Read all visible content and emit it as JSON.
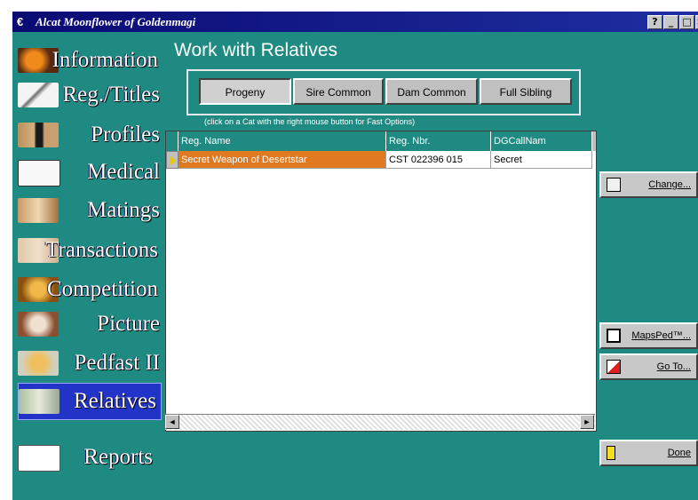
{
  "window": {
    "title": "Alcat Moonflower of Goldenmagi",
    "buttons": [
      "?",
      "_",
      "□",
      "×"
    ]
  },
  "nav": {
    "items": [
      {
        "label": "Information",
        "icon": "pumpkin-icon"
      },
      {
        "label": "Reg./Titles",
        "icon": "pen-icon"
      },
      {
        "label": "Profiles",
        "icon": "black-cat-icon"
      },
      {
        "label": "Medical",
        "icon": "caduceus-icon"
      },
      {
        "label": "Matings",
        "icon": "cats-icon"
      },
      {
        "label": "Transactions",
        "icon": "handshake-icon"
      },
      {
        "label": "Competition",
        "icon": "trophy-icon"
      },
      {
        "label": "Picture",
        "icon": "cat-face-icon"
      },
      {
        "label": "Pedfast II",
        "icon": "pedestal-icon"
      },
      {
        "label": "Relatives",
        "icon": "family-icon",
        "active": true
      },
      {
        "label": "Reports",
        "icon": "report-icon"
      }
    ]
  },
  "main": {
    "title": "Work with Relatives",
    "tabs": [
      {
        "label": "Progeny",
        "pressed": true
      },
      {
        "label": "Sire Common",
        "pressed": false
      },
      {
        "label": "Dam Common",
        "pressed": false
      },
      {
        "label": "Full Sibling",
        "pressed": false
      }
    ],
    "hint": "(click on a Cat with the right mouse button for Fast Options)",
    "table": {
      "columns": [
        "Reg. Name",
        "Reg. Nbr.",
        "DGCallNam"
      ],
      "rows": [
        {
          "name": "Secret Weapon of Desertstar",
          "number": "CST 022396 015",
          "call_name": "Secret"
        }
      ]
    }
  },
  "side_buttons": {
    "change": "Change...",
    "mapsped": "MapsPed™...",
    "goto": "Go To...",
    "done": "Done"
  },
  "colors": {
    "background": "#1f8a82",
    "titlebar": "#0a0a72",
    "selected_row": "#e07a22",
    "active_nav": "#2233c8"
  }
}
